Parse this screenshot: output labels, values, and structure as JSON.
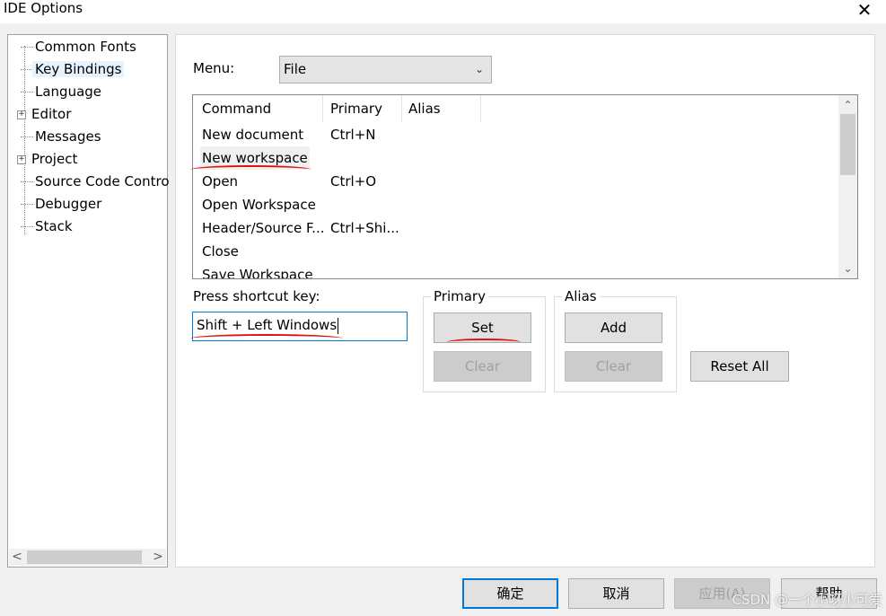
{
  "window": {
    "title": "IDE Options",
    "close_glyph": "✕"
  },
  "tree": {
    "items": [
      {
        "label": "Common Fonts",
        "expandable": false,
        "selected": false
      },
      {
        "label": "Key Bindings",
        "expandable": false,
        "selected": true
      },
      {
        "label": "Language",
        "expandable": false,
        "selected": false
      },
      {
        "label": "Editor",
        "expandable": true,
        "selected": false
      },
      {
        "label": "Messages",
        "expandable": false,
        "selected": false
      },
      {
        "label": "Project",
        "expandable": true,
        "selected": false
      },
      {
        "label": "Source Code Contro",
        "expandable": false,
        "selected": false
      },
      {
        "label": "Debugger",
        "expandable": false,
        "selected": false
      },
      {
        "label": "Stack",
        "expandable": false,
        "selected": false
      }
    ],
    "expand_glyph": "+",
    "scroll_left": "<",
    "scroll_right": ">"
  },
  "menu": {
    "label": "Menu:",
    "value": "File"
  },
  "list": {
    "headers": [
      "Command",
      "Primary",
      "Alias"
    ],
    "rows": [
      {
        "command": "New document",
        "primary": "Ctrl+N",
        "alias": ""
      },
      {
        "command": "New workspace",
        "primary": "",
        "alias": ""
      },
      {
        "command": "Open",
        "primary": "Ctrl+O",
        "alias": ""
      },
      {
        "command": "Open Workspace",
        "primary": "",
        "alias": ""
      },
      {
        "command": "Header/Source F...",
        "primary": "Ctrl+Shi...",
        "alias": ""
      },
      {
        "command": "Close",
        "primary": "",
        "alias": ""
      },
      {
        "command": "Save Workspace",
        "primary": "",
        "alias": ""
      }
    ],
    "selected_index": 1
  },
  "shortcut": {
    "label": "Press shortcut key:",
    "value": "Shift + Left Windows"
  },
  "primary_group": {
    "title": "Primary",
    "set_label": "Set",
    "clear_label": "Clear"
  },
  "alias_group": {
    "title": "Alias",
    "add_label": "Add",
    "clear_label": "Clear"
  },
  "reset_all_label": "Reset All",
  "footer": {
    "ok_label": "确定",
    "cancel_label": "取消",
    "apply_label": "应用(A)",
    "help_label": "帮助"
  },
  "watermark": "CSDN @一个小呀小可爱",
  "colors": {
    "accent": "#0078d7",
    "annotation": "#e01010"
  }
}
